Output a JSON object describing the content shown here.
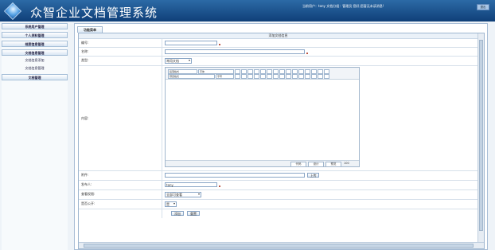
{
  "app": {
    "title": "众智企业文档管理系统",
    "user_bar": "当前用户：tony  文档分组：管理员  您好,您暂无未读消息!",
    "exit_label": "退出"
  },
  "sidebar": {
    "items": [
      {
        "label": "系统用户管理"
      },
      {
        "label": "个人资料管理"
      },
      {
        "label": "档案信息管理"
      },
      {
        "label": "文档信息管理"
      },
      {
        "label": "文档信息添加"
      },
      {
        "label": "文档信息管理"
      },
      {
        "label": "文档管理"
      }
    ]
  },
  "main": {
    "tab_label": "功能菜单",
    "form_title": "添加文档信息",
    "fields": {
      "number_label": "编号:",
      "name_label": "名称:",
      "type_label": "类型:",
      "type_value": "常用文档",
      "content_label": "内容:",
      "attachment_label": "附件:",
      "upload_label": "上传",
      "publisher_label": "发布人:",
      "publisher_value": "tony",
      "permission_label": "查看权限:",
      "permission_value": "全部可查看",
      "public_label": "是否公开:",
      "public_value": "是"
    },
    "editor": {
      "format_select": "段落格式",
      "font_select": "字体",
      "size_select": "字号",
      "style_select": "预置格式",
      "mode_code": "代码",
      "mode_design": "设计",
      "mode_preview": "预览",
      "zoom_label": "100"
    },
    "submit_label": "添加",
    "reset_label": "重置"
  }
}
